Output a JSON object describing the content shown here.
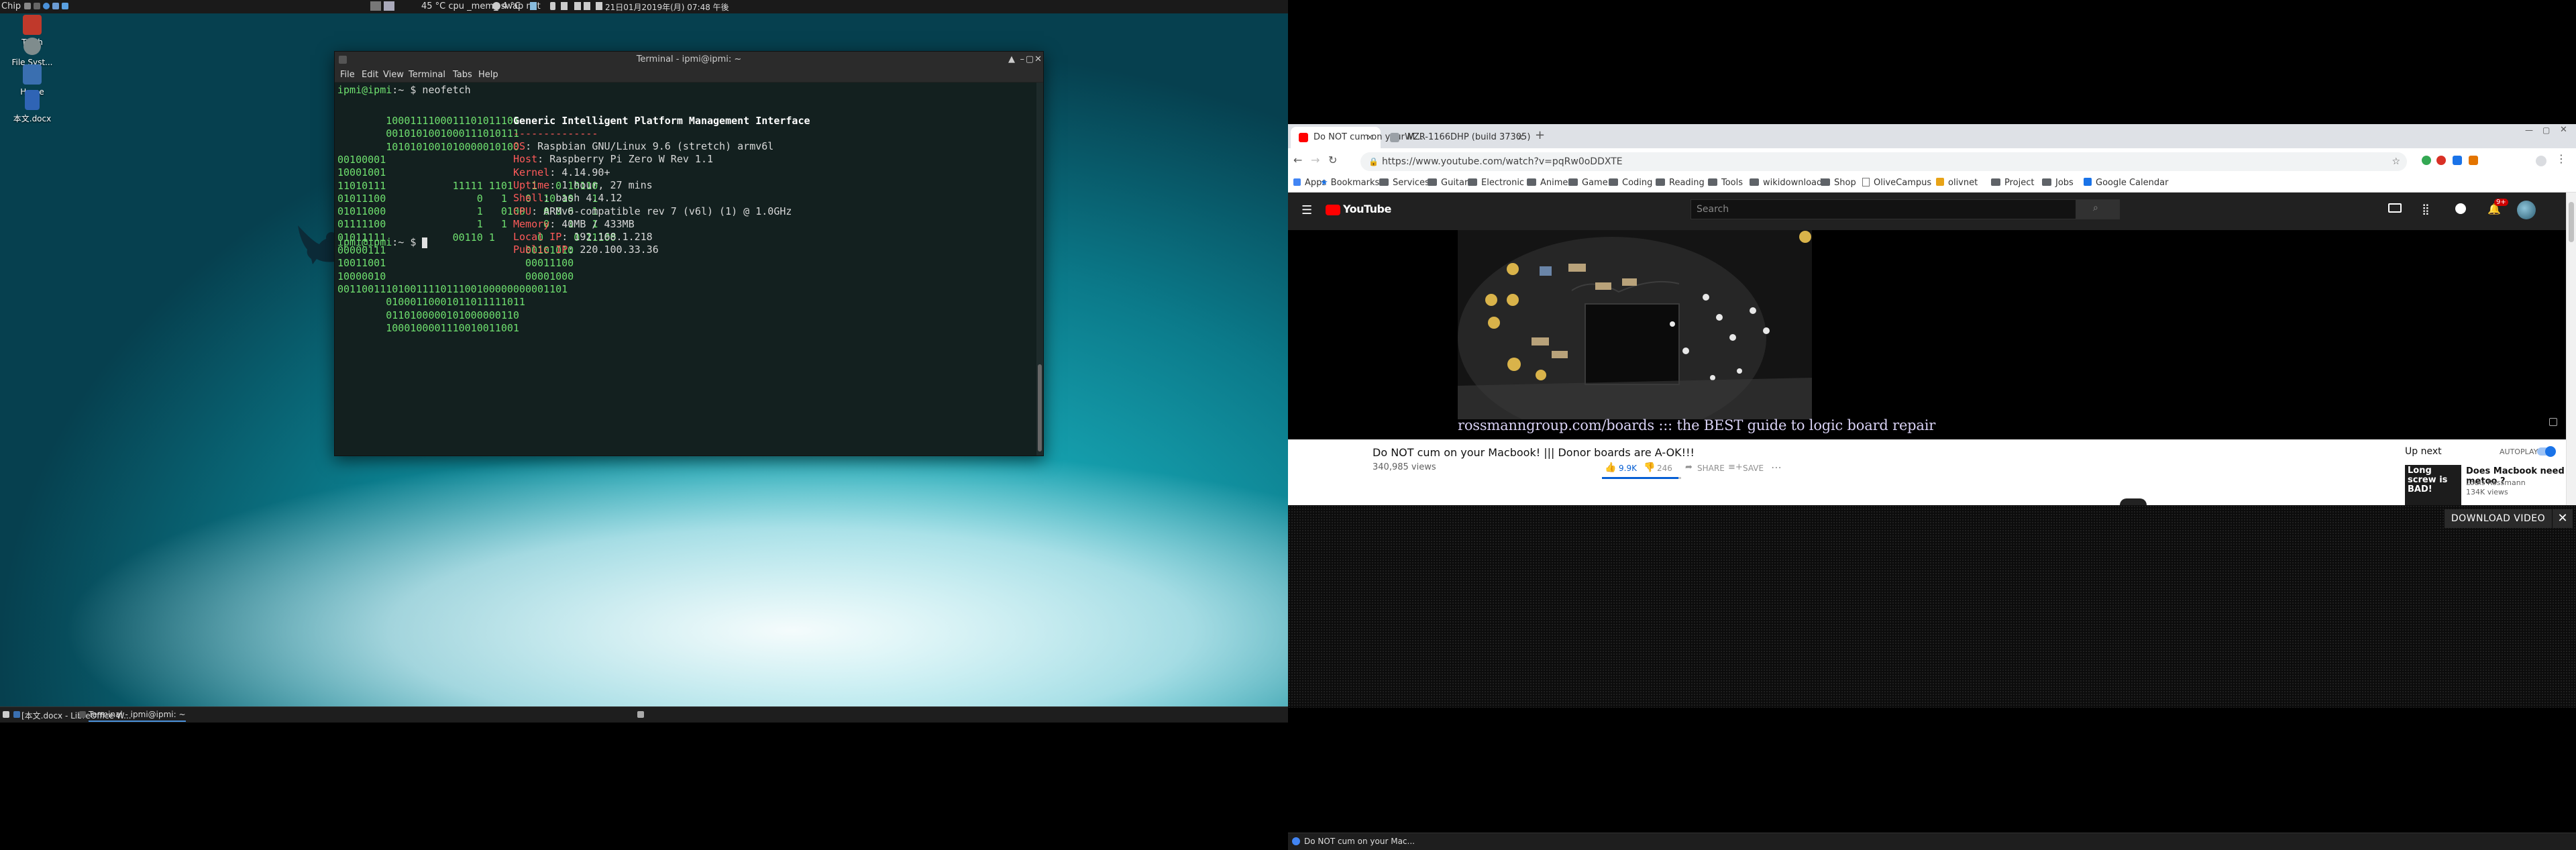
{
  "left": {
    "top_panel": {
      "app_label": "Chip",
      "sensors": "45 °C cpu _mem_ swap net",
      "weather": "4 °C",
      "clock": "21日01月2019年(月) 07:48 午後"
    },
    "desktop_icons": [
      {
        "label": "Trash"
      },
      {
        "label": "File Syst..."
      },
      {
        "label": "Home"
      },
      {
        "label": "本文.docx"
      }
    ],
    "terminal": {
      "title": "Terminal - ipmi@ipmi: ~",
      "menu": [
        "File",
        "Edit",
        "View",
        "Terminal",
        "Tabs",
        "Help"
      ],
      "prompt": "ipmi@ipmi",
      "prompt_suffix": ":~ $",
      "command": " neofetch",
      "ascii_art": [
        "        1000111100011101011101",
        "        0010101001000111010111",
        "        1010101001010000010100",
        "00100001",
        "10001001",
        "11010111           11111 1101   1   0 10110",
        "01011100               0   1   0  10 10   1",
        "01011000               1   0100   0 0 0   1",
        "01111100               1   1      0   1   1",
        "01011111           00110 1       0     0 11100",
        "00000111                       00101010",
        "10011001                       00011100",
        "10000010                       00001000",
        "00110011101001111011100100000000001101",
        "        01000110001011011111011",
        "        0110100000101000000110",
        "        1000100001110010011001"
      ],
      "info_title": "Generic Intelligent Platform Management Interface",
      "info_separator": "--------------",
      "info": [
        {
          "key": "OS",
          "value": "Raspbian GNU/Linux 9.6 (stretch) armv6l"
        },
        {
          "key": "Host",
          "value": "Raspberry Pi Zero W Rev 1.1"
        },
        {
          "key": "Kernel",
          "value": "4.14.90+"
        },
        {
          "key": "Uptime",
          "value": "1 hour, 27 mins"
        },
        {
          "key": "Shell",
          "value": "bash 4.4.12"
        },
        {
          "key": "CPU",
          "value": "ARMv6-compatible rev 7 (v6l) (1) @ 1.0GHz"
        },
        {
          "key": "Memory",
          "value": "40MB / 433MB"
        },
        {
          "key": "Local IP",
          "value": "192.168.1.218"
        },
        {
          "key": "Public IP",
          "value": "220.100.33.36"
        }
      ]
    },
    "taskbar": [
      {
        "label": "[本文.docx - LibreOffice W..."
      },
      {
        "label": "Terminal - ipmi@ipmi: ~"
      }
    ]
  },
  "right": {
    "tabs": [
      {
        "label": "Do NOT cum on your M...",
        "active": true,
        "color": "#ff0000"
      },
      {
        "label": "WZR-1166DHP (build 37305)",
        "active": false,
        "color": "#9aa0a6"
      }
    ],
    "url": "https://www.youtube.com/watch?v=pqRw0oDDXTE",
    "bookmarks": [
      "Apps",
      "Bookmarks",
      "Services",
      "Guitar",
      "Electronic",
      "Anime",
      "Game",
      "Coding",
      "Reading",
      "Tools",
      "wikidownload",
      "Shop",
      "OliveCampus",
      "olivnet",
      "Project",
      "Jobs",
      "Google Calendar"
    ],
    "youtube": {
      "logo": "YouTube",
      "search_placeholder": "Search",
      "notifications": "9+",
      "video_caption": "rossmanngroup.com/boards ::: the BEST guide to logic board repair",
      "video_title": "Do NOT cum on your Macbook! ||| Donor boards are A-OK!!!",
      "views": "340,985 views",
      "likes": "9.9K",
      "dislikes": "246",
      "share": "SHARE",
      "save": "SAVE",
      "up_next": "Up next",
      "autoplay": "AUTOPLAY",
      "next_title": "Does Macbook need metoo ?",
      "next_channel": "Louis Rossmann",
      "next_views": "134K views",
      "next_thumb_text": "Long screw is BAD!"
    },
    "download_video": "DOWNLOAD VIDEO",
    "taskbar_item": "Do NOT cum on your Mac..."
  }
}
